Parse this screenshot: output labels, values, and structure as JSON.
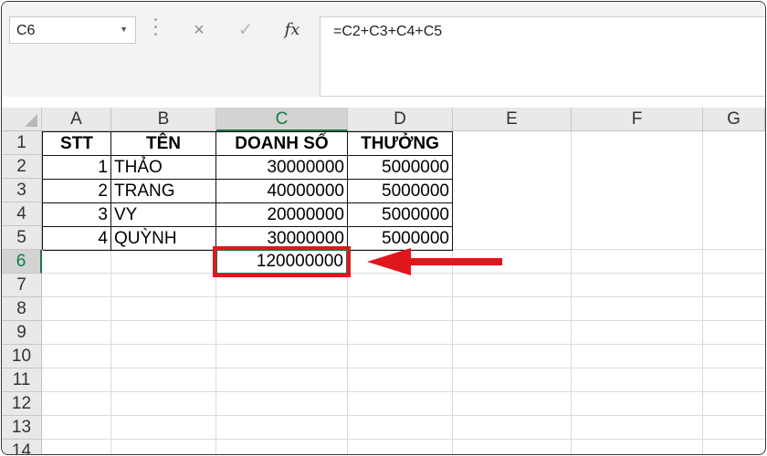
{
  "name_box": {
    "value": "C6"
  },
  "formula_bar": {
    "cancel_icon": "×",
    "enter_icon": "✓",
    "fx_icon": "fx",
    "formula": "=C2+C3+C4+C5"
  },
  "columns": [
    "A",
    "B",
    "C",
    "D",
    "E",
    "F",
    "G"
  ],
  "selected_column": "C",
  "rows": [
    "1",
    "2",
    "3",
    "4",
    "5",
    "6",
    "7",
    "8",
    "9",
    "10",
    "11",
    "12",
    "13",
    "14"
  ],
  "selected_row": "6",
  "table": {
    "headers": [
      "STT",
      "TÊN",
      "DOANH SỐ",
      "THƯỞNG"
    ],
    "records": [
      [
        "1",
        "THẢO",
        "30000000",
        "5000000"
      ],
      [
        "2",
        "TRANG",
        "40000000",
        "5000000"
      ],
      [
        "3",
        "VY",
        "20000000",
        "5000000"
      ],
      [
        "4",
        "QUỲNH",
        "30000000",
        "5000000"
      ]
    ]
  },
  "total": {
    "cell": "C6",
    "value": "120000000"
  },
  "colors": {
    "accent": "#217346",
    "highlight": "#e0171c"
  },
  "icons": {
    "annotation": "arrow-left-icon"
  }
}
